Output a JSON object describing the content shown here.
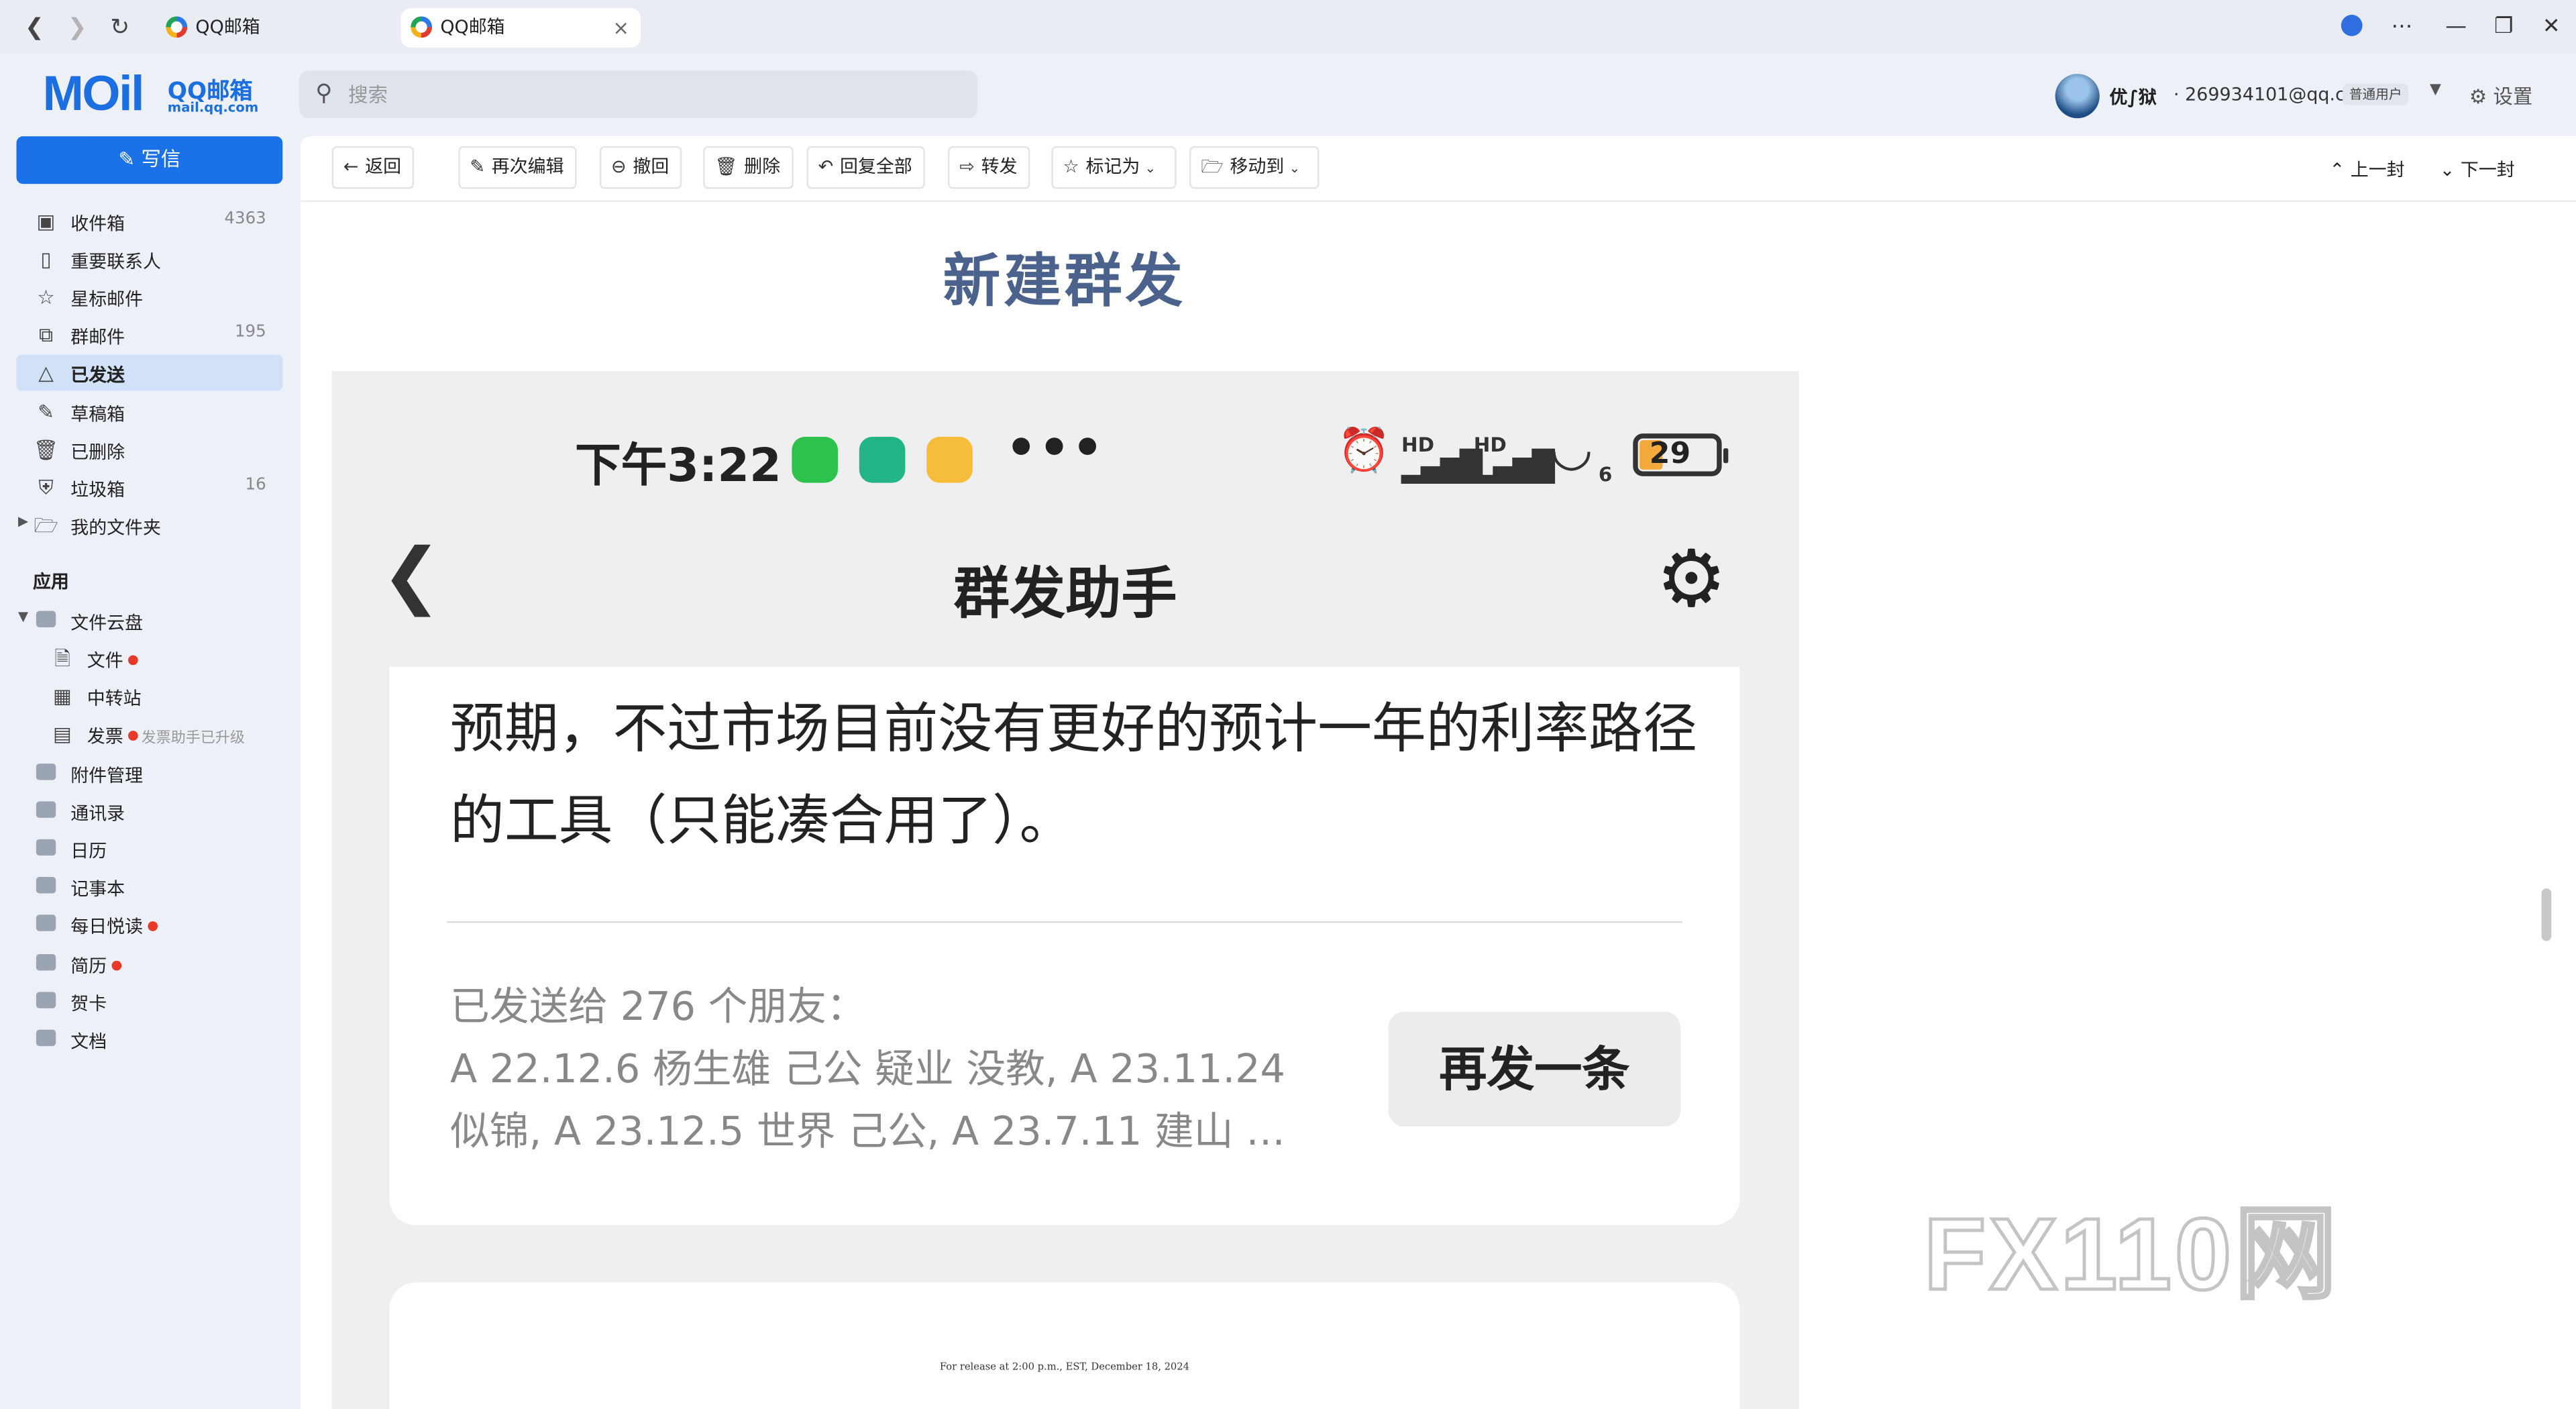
{
  "browser": {
    "tabs": [
      {
        "title": "QQ邮箱"
      },
      {
        "title": "QQ邮箱"
      }
    ],
    "close_glyph": "×"
  },
  "header": {
    "logo_text": "MOil",
    "logo_sub": "QQ邮箱",
    "logo_domain": "mail.qq.com",
    "search_placeholder": "搜索",
    "user_name": "优∫狱",
    "user_email": "· 269934101@qq.com",
    "user_badge": "普通用户",
    "settings_label": "设置"
  },
  "sidebar": {
    "compose_label": "写信",
    "folders": [
      {
        "label": "收件箱",
        "count": "4363",
        "icon": "inbox-icon"
      },
      {
        "label": "重要联系人",
        "count": "",
        "icon": "bookmark-icon"
      },
      {
        "label": "星标邮件",
        "count": "",
        "icon": "star-icon"
      },
      {
        "label": "群邮件",
        "count": "195",
        "icon": "group-mail-icon"
      },
      {
        "label": "已发送",
        "count": "",
        "icon": "sent-icon"
      },
      {
        "label": "草稿箱",
        "count": "",
        "icon": "draft-icon"
      },
      {
        "label": "已删除",
        "count": "",
        "icon": "trash-icon"
      },
      {
        "label": "垃圾箱",
        "count": "16",
        "icon": "spam-icon"
      },
      {
        "label": "我的文件夹",
        "count": "",
        "icon": "folder-icon"
      }
    ],
    "apps_title": "应用",
    "apps": [
      {
        "label": "文件云盘"
      },
      {
        "label": "文件"
      },
      {
        "label": "中转站"
      },
      {
        "label": "发票",
        "hint": "发票助手已升级"
      },
      {
        "label": "附件管理"
      },
      {
        "label": "通讯录"
      },
      {
        "label": "日历"
      },
      {
        "label": "记事本"
      },
      {
        "label": "每日悦读"
      },
      {
        "label": "简历"
      },
      {
        "label": "贺卡"
      },
      {
        "label": "文档"
      }
    ]
  },
  "toolbar": {
    "back": "返回",
    "reedit": "再次编辑",
    "recall": "撤回",
    "delete": "删除",
    "reply_all": "回复全部",
    "forward": "转发",
    "mark_as": "标记为",
    "move_to": "移动到",
    "prev": "上一封",
    "next": "下一封"
  },
  "email": {
    "subject": "新建群发"
  },
  "phone": {
    "time": "下午3:22",
    "dots": "•••",
    "hd1": "HD",
    "hd2": "HD",
    "wifi_num": "6",
    "battery": "29",
    "title": "群发助手",
    "message": "预期，不过市场目前没有更好的预计一年的利率路径的工具（只能凑合用了）。",
    "sent_to": "已发送给 276 个朋友：\nA 22.12.6 杨生雄 己公 疑业 没教, A 23.11.24\n似锦, A 23.12.5 世界 己公, A 23.7.11 建山 …",
    "resend": "再发一条",
    "release_note": "For release at 2:00 p.m., EST, December 18, 2024"
  },
  "watermark": "FX110网",
  "colors": {
    "accent": "#1b72e8",
    "active_folder": "#d1e1f7",
    "subject": "#4b628c",
    "badge_dot": "#e83828"
  }
}
